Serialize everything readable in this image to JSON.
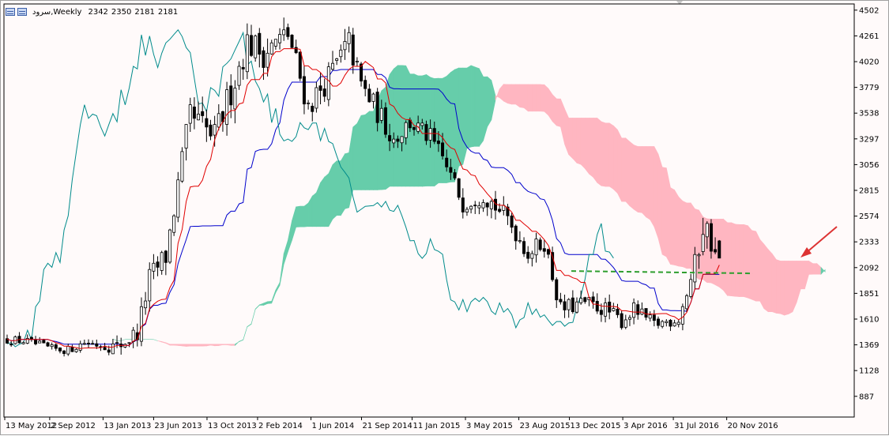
{
  "header": {
    "symbol": "سرود",
    "timeframe": "Weekly",
    "open": "2342",
    "high": "2350",
    "low": "2181",
    "close": "2181"
  },
  "colors": {
    "background": "#fffafa",
    "tenkan": "#e00000",
    "kijun": "#0000cc",
    "chikou": "#008b8b",
    "kumo_bull": "#66cdaa",
    "kumo_bear": "#ffb6c1",
    "level_line": "#2e9e2e",
    "arrow": "#dd3333",
    "axis_text": "#000000"
  },
  "chart_data": {
    "type": "candlestick",
    "indicator": "ichimoku",
    "ylim": [
      693,
      4560
    ],
    "yticks": [
      4502,
      4261,
      4020,
      3779,
      3538,
      3297,
      3056,
      2815,
      2574,
      2333,
      2092,
      1851,
      1610,
      1369,
      1128,
      887
    ],
    "xtick_labels": [
      "13 May 2012",
      "2 Sep 2012",
      "13 Jan 2013",
      "23 Jun 2013",
      "13 Oct 2013",
      "2 Feb 2014",
      "1 Jun 2014",
      "21 Sep 2014",
      "11 Jan 2015",
      "3 May 2015",
      "23 Aug 2015",
      "13 Dec 2015",
      "3 Apr 2016",
      "31 Jul 2016",
      "20 Nov 2016"
    ],
    "horizontal_level": 2060,
    "price_path": [
      [
        0,
        1420
      ],
      [
        6,
        1400
      ],
      [
        12,
        1330
      ],
      [
        16,
        1320
      ],
      [
        20,
        1390
      ],
      [
        28,
        1350
      ],
      [
        33,
        1480
      ],
      [
        36,
        1990
      ],
      [
        40,
        2200
      ],
      [
        46,
        3500
      ],
      [
        52,
        3300
      ],
      [
        60,
        4200
      ],
      [
        64,
        4100
      ],
      [
        70,
        4280
      ],
      [
        75,
        3600
      ],
      [
        80,
        3870
      ],
      [
        85,
        4200
      ],
      [
        88,
        3800
      ],
      [
        96,
        3300
      ],
      [
        100,
        3450
      ],
      [
        105,
        3300
      ],
      [
        108,
        3110
      ],
      [
        113,
        2700
      ],
      [
        118,
        2780
      ],
      [
        124,
        2550
      ],
      [
        129,
        2230
      ],
      [
        133,
        2330
      ],
      [
        137,
        1700
      ],
      [
        143,
        1760
      ],
      [
        148,
        1700
      ],
      [
        152,
        1590
      ],
      [
        155,
        1700
      ],
      [
        160,
        1560
      ],
      [
        166,
        1610
      ],
      [
        170,
        2100
      ],
      [
        172,
        2500
      ],
      [
        174,
        2350
      ],
      [
        175,
        2181
      ]
    ],
    "volatility": [
      [
        0,
        50
      ],
      [
        20,
        50
      ],
      [
        36,
        140
      ],
      [
        46,
        200
      ],
      [
        80,
        160
      ],
      [
        105,
        120
      ],
      [
        130,
        110
      ],
      [
        150,
        90
      ],
      [
        165,
        70
      ],
      [
        171,
        200
      ],
      [
        175,
        170
      ]
    ]
  }
}
